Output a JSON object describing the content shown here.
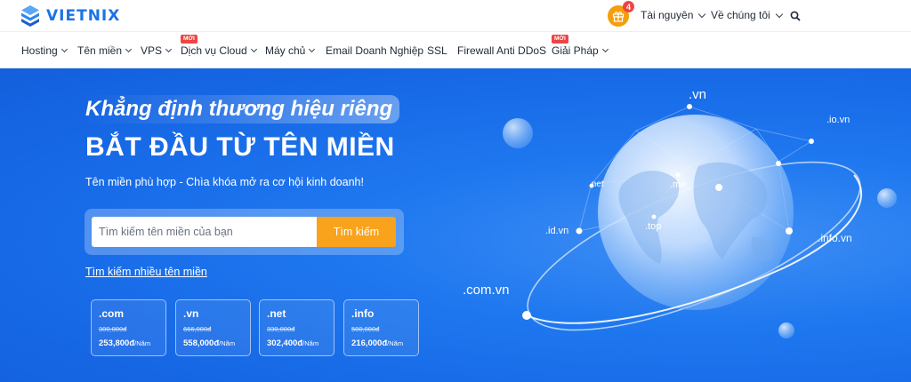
{
  "brand": {
    "name": "VIETNIX"
  },
  "topbar": {
    "gift_count": "4",
    "resources_label": "Tài nguyên",
    "about_label": "Về chúng tôi"
  },
  "nav": {
    "items": [
      {
        "label": "Hosting",
        "has_dropdown": true
      },
      {
        "label": "Tên miền",
        "has_dropdown": true
      },
      {
        "label": "VPS",
        "has_dropdown": true
      },
      {
        "label": "Dịch vụ Cloud",
        "has_dropdown": true,
        "badge": "MỚI"
      },
      {
        "label": "Máy chủ",
        "has_dropdown": true
      },
      {
        "label": "Email Doanh Nghiệp",
        "has_dropdown": false
      },
      {
        "label": "SSL",
        "has_dropdown": false
      },
      {
        "label": "Firewall Anti DDoS",
        "has_dropdown": false
      },
      {
        "label": "Giải Pháp",
        "has_dropdown": true,
        "badge": "MỚI"
      }
    ]
  },
  "hero": {
    "tagline": "Khẳng định thương hiệu riêng",
    "headline": "BẮT ĐẦU TỪ TÊN MIỀN",
    "subtext": "Tên miền phù hợp - Chìa khóa mở ra cơ hội kinh doanh!",
    "search": {
      "placeholder": "Tìm kiếm tên miền của bạn",
      "button_label": "Tìm kiếm"
    },
    "multi_search_link": "Tìm kiếm nhiều tên miền",
    "prices": [
      {
        "ext": ".com",
        "old": "300,000đ",
        "new": "253,800đ",
        "unit": "/Năm"
      },
      {
        "ext": ".vn",
        "old": "666,000đ",
        "new": "558,000đ",
        "unit": "/Năm"
      },
      {
        "ext": ".net",
        "old": "330,000đ",
        "new": "302,400đ",
        "unit": "/Năm"
      },
      {
        "ext": ".info",
        "old": "500,000đ",
        "new": "216,000đ",
        "unit": "/Năm"
      }
    ],
    "globe_labels": {
      "vn": ".vn",
      "io_vn": ".io.vn",
      "net": ".net",
      "me": ".me",
      "id_vn": ".id.vn",
      "top": ".top",
      "info_vn": ".info.vn",
      "com_vn": ".com.vn"
    }
  },
  "colors": {
    "primary": "#1a73e8",
    "hero_bg": "#1769e6",
    "accent": "#f9a21c",
    "badge": "#ef4444"
  }
}
